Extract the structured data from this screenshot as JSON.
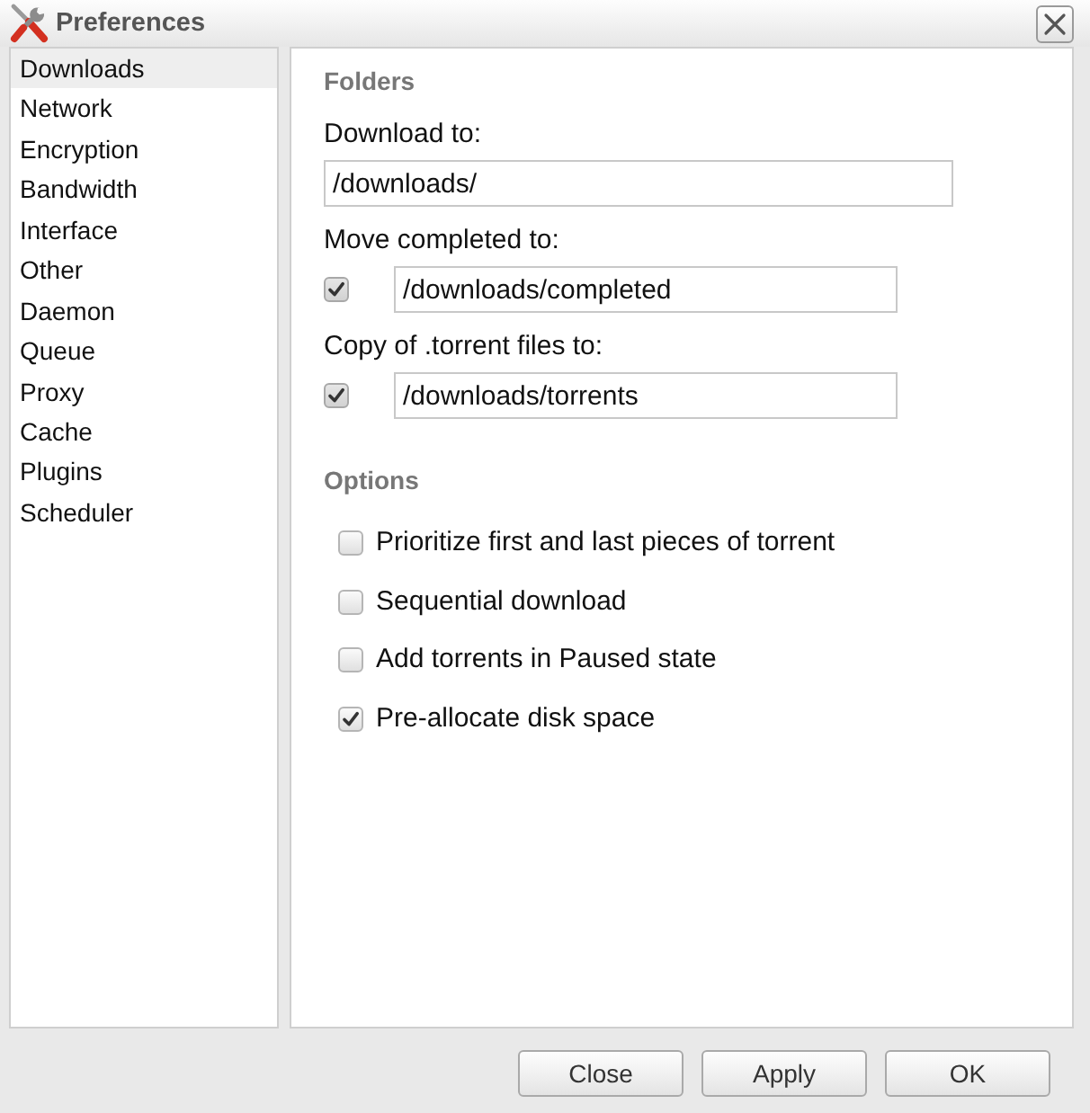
{
  "window": {
    "title": "Preferences"
  },
  "sidebar": {
    "items": [
      {
        "label": "Downloads",
        "selected": true
      },
      {
        "label": "Network",
        "selected": false
      },
      {
        "label": "Encryption",
        "selected": false
      },
      {
        "label": "Bandwidth",
        "selected": false
      },
      {
        "label": "Interface",
        "selected": false
      },
      {
        "label": "Other",
        "selected": false
      },
      {
        "label": "Daemon",
        "selected": false
      },
      {
        "label": "Queue",
        "selected": false
      },
      {
        "label": "Proxy",
        "selected": false
      },
      {
        "label": "Cache",
        "selected": false
      },
      {
        "label": "Plugins",
        "selected": false
      },
      {
        "label": "Scheduler",
        "selected": false
      }
    ]
  },
  "folders": {
    "heading": "Folders",
    "fields": [
      {
        "kind": "plain",
        "label": "Download to:",
        "value": "/downloads/"
      },
      {
        "kind": "toggle",
        "label": "Move completed to:",
        "checked": true,
        "value": "/downloads/completed"
      },
      {
        "kind": "toggle",
        "label": "Copy of .torrent files to:",
        "checked": true,
        "value": "/downloads/torrents"
      }
    ]
  },
  "options": {
    "heading": "Options",
    "items": [
      {
        "label": "Prioritize first and last pieces of torrent",
        "checked": false
      },
      {
        "label": "Sequential download",
        "checked": false
      },
      {
        "label": "Add torrents in Paused state",
        "checked": false
      },
      {
        "label": "Pre-allocate disk space",
        "checked": true
      }
    ]
  },
  "buttons": [
    "Close",
    "Apply",
    "OK"
  ]
}
